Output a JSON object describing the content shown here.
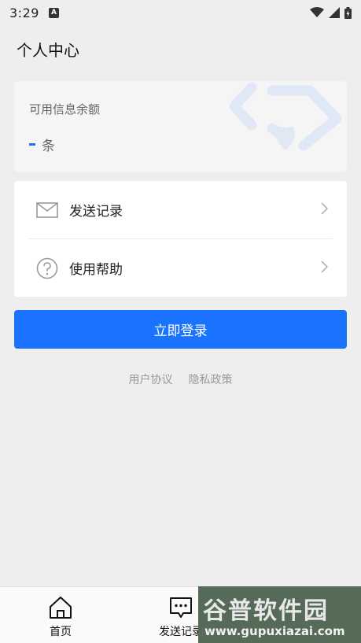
{
  "status_bar": {
    "time": "3:29",
    "a_badge": "A"
  },
  "page": {
    "title": "个人中心"
  },
  "balance": {
    "label": "可用信息余额",
    "unit": "条"
  },
  "menu": {
    "items": [
      {
        "label": "发送记录",
        "icon": "mail-icon"
      },
      {
        "label": "使用帮助",
        "icon": "help-circle-icon"
      }
    ]
  },
  "login": {
    "label": "立即登录"
  },
  "links": {
    "user_agreement": "用户协议",
    "privacy_policy": "隐私政策"
  },
  "tab_bar": {
    "tabs": [
      {
        "label": "首页",
        "icon": "home-icon"
      },
      {
        "label": "发送记录",
        "icon": "message-icon"
      }
    ]
  },
  "watermark": {
    "title": "谷普软件园",
    "url": "www.gupuxiazai.com"
  },
  "colors": {
    "accent": "#1a73ff",
    "background": "#eeeeee"
  }
}
